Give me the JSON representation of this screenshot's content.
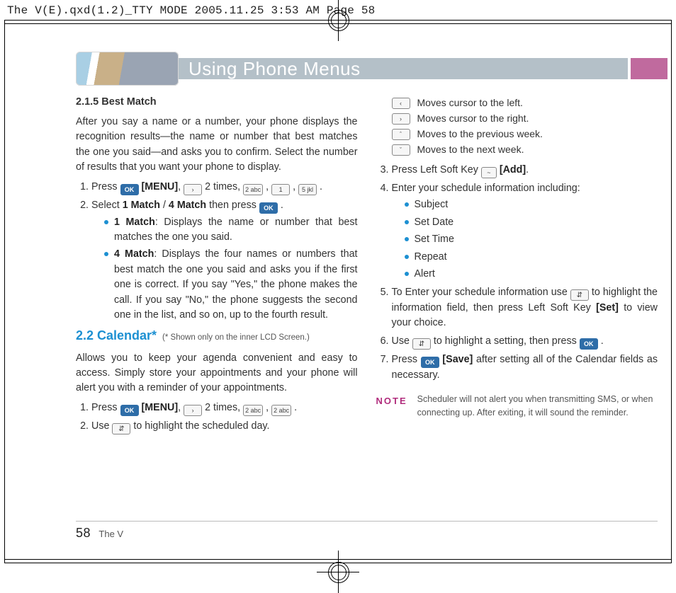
{
  "slug": "The V(E).qxd(1.2)_TTY MODE  2005.11.25  3:53 AM  Page 58",
  "header": {
    "title": "Using Phone Menus"
  },
  "left": {
    "h_best": "2.1.5 Best Match",
    "p_best": "After you say a name or a number, your phone displays the recognition results—the name or number that best matches the one you said—and asks you to confirm. Select the number of results that you want your phone to display.",
    "s1_a": "Press ",
    "s1_menu": "[MENU]",
    "s1_b": ", ",
    "s1_c": " 2 times, ",
    "s1_d": " , ",
    "s1_e": " , ",
    "s1_f": " .",
    "s2_a": "Select ",
    "s2_b": "1 Match",
    "s2_c": " / ",
    "s2_d": "4 Match",
    "s2_e": " then press ",
    "m1_a": "1 Match",
    "m1_b": ": Displays the name or number that best matches the one you said.",
    "m4_a": "4 Match",
    "m4_b": ": Displays the four names or numbers that best match the one you said and asks you if the first one is correct. If you say \"Yes,\" the phone makes the call. If you say \"No,\" the phone suggests the second one in the list, and so on, up to the fourth result.",
    "h_cal": "2.2 Calendar*",
    "cal_note": "(*  Shown only on the inner LCD Screen.)",
    "p_cal": "Allows you to keep your agenda convenient and easy to access. Simply store your appointments and your phone will alert you with a reminder of your appointments.",
    "c1_a": "Press ",
    "c1_menu": "[MENU]",
    "c1_b": ", ",
    "c1_c": " 2 times, ",
    "c1_d": " , ",
    "c1_e": " .",
    "c2_a": "Use ",
    "c2_b": " to highlight the scheduled day."
  },
  "right": {
    "arw_left": "Moves cursor to the left.",
    "arw_right": "Moves cursor to the right.",
    "arw_up": "Moves to the previous week.",
    "arw_dn": "Moves to the next week.",
    "s3_a": "Press Left Soft Key ",
    "s3_b": "[Add]",
    "s3_c": ".",
    "s4": "Enter your schedule information including:",
    "b1": "Subject",
    "b2": "Set Date",
    "b3": "Set Time",
    "b4": "Repeat",
    "b5": "Alert",
    "s5_a": "To Enter your schedule information use ",
    "s5_b": " to highlight the information field, then press Left Soft Key ",
    "s5_set": "[Set]",
    "s5_c": " to  view your choice.",
    "s6_a": "Use ",
    "s6_b": " to highlight a setting, then press ",
    "s6_c": " .",
    "s7_a": "Press ",
    "s7_save": "[Save]",
    "s7_b": " after setting all of the Calendar fields as necessary.",
    "note_lbl": "NOTE",
    "note_txt": "Scheduler will not alert you when transmitting SMS, or when connecting up. After exiting, it will sound the reminder."
  },
  "keys": {
    "ok": "OK",
    "k2": "2 abc",
    "k1": "1",
    "k5": "5 jkl",
    "soft": "~"
  },
  "footer": {
    "page": "58",
    "book": "The V"
  }
}
